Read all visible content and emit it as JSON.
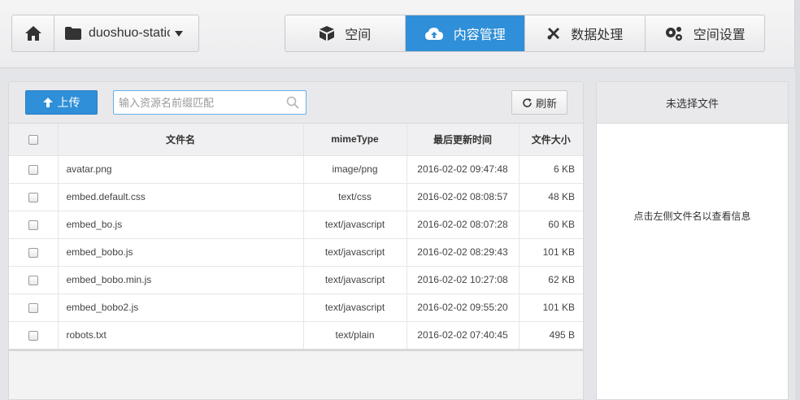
{
  "header": {
    "bucket_name": "duoshuo-static",
    "tabs": [
      {
        "label": "空间",
        "icon": "box-icon",
        "active": false
      },
      {
        "label": "内容管理",
        "icon": "cloud-upload-icon",
        "active": true
      },
      {
        "label": "数据处理",
        "icon": "tools-icon",
        "active": false
      },
      {
        "label": "空间设置",
        "icon": "gears-icon",
        "active": false
      }
    ]
  },
  "toolbar": {
    "upload_label": "上传",
    "search_placeholder": "输入资源名前缀匹配",
    "refresh_label": "刷新"
  },
  "table": {
    "columns": [
      "文件名",
      "mimeType",
      "最后更新时间",
      "文件大小"
    ],
    "rows": [
      {
        "name": "avatar.png",
        "mime": "image/png",
        "time": "2016-02-02 09:47:48",
        "size": "6 KB"
      },
      {
        "name": "embed.default.css",
        "mime": "text/css",
        "time": "2016-02-02 08:08:57",
        "size": "48 KB"
      },
      {
        "name": "embed_bo.js",
        "mime": "text/javascript",
        "time": "2016-02-02 08:07:28",
        "size": "60 KB"
      },
      {
        "name": "embed_bobo.js",
        "mime": "text/javascript",
        "time": "2016-02-02 08:29:43",
        "size": "101 KB"
      },
      {
        "name": "embed_bobo.min.js",
        "mime": "text/javascript",
        "time": "2016-02-02 10:27:08",
        "size": "62 KB"
      },
      {
        "name": "embed_bobo2.js",
        "mime": "text/javascript",
        "time": "2016-02-02 09:55:20",
        "size": "101 KB"
      },
      {
        "name": "robots.txt",
        "mime": "text/plain",
        "time": "2016-02-02 07:40:45",
        "size": "495 B"
      }
    ]
  },
  "side": {
    "title": "未选择文件",
    "hint": "点击左侧文件名以查看信息"
  },
  "colors": {
    "accent": "#2f8fd8",
    "background": "#e4e5e9"
  }
}
